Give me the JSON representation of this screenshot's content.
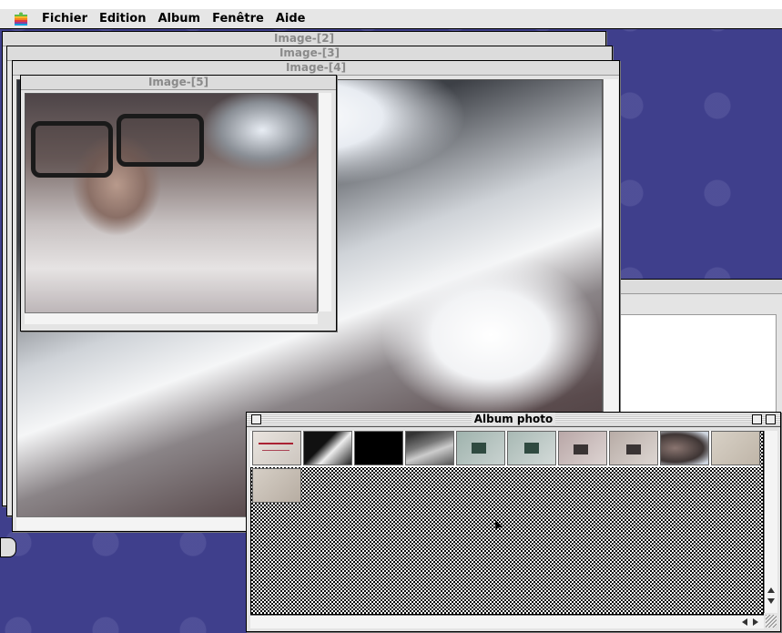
{
  "menu": {
    "apple_icon": "apple-menu-icon",
    "items": [
      "Fichier",
      "Edition",
      "Album",
      "Fenêtre",
      "Aide"
    ]
  },
  "windows": {
    "image2": {
      "title": "Image-[2]"
    },
    "image3": {
      "title": "Image-[3]"
    },
    "image4": {
      "title": "Image-[4]"
    },
    "image5": {
      "title": "Image-[5]"
    }
  },
  "album": {
    "title": "Album photo",
    "thumbnails": [
      "note-photo",
      "dark-screen-photo",
      "black-photo",
      "hand-photo",
      "camera-photo-1",
      "camera-photo-2",
      "camera-photo-3",
      "camera-photo-4",
      "face-photo",
      "cable-photo",
      "shirt-photo"
    ]
  },
  "colors": {
    "desktop": "#3f3f8c",
    "menubar": "#e6e6e6",
    "window": "#e4e4e4"
  }
}
